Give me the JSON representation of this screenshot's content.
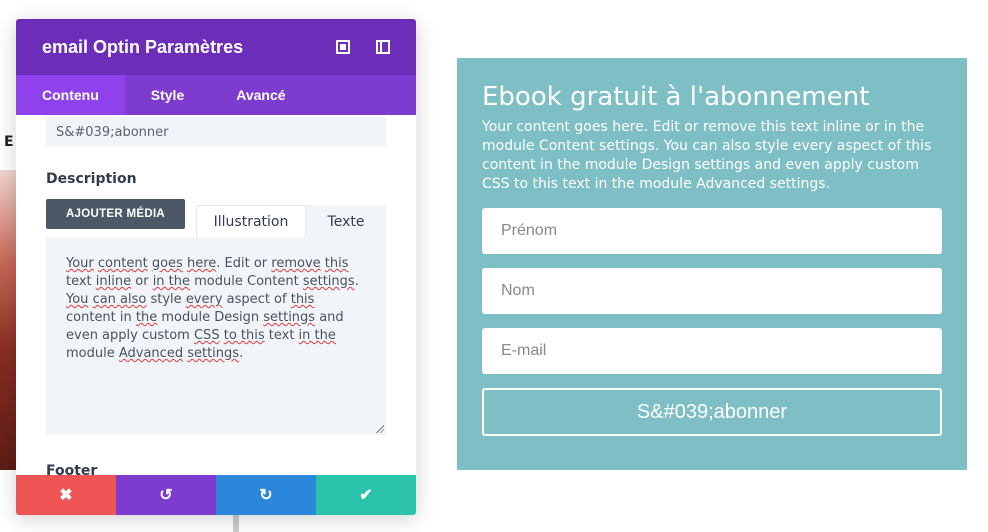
{
  "modal": {
    "title": "email Optin Paramètres",
    "tabs": [
      {
        "label": "Contenu"
      },
      {
        "label": "Style"
      },
      {
        "label": "Avancé"
      }
    ],
    "button_text_value": "S&#039;abonner",
    "description_label": "Description",
    "add_media_label": "AJOUTER MÉDIA",
    "editor_tabs": [
      {
        "label": "Illustration"
      },
      {
        "label": "Texte"
      }
    ],
    "editor_text": {
      "w1": "Your",
      "w2": "content",
      "w3": "goes",
      "w4": "here",
      "t1": ". Edit or ",
      "w5": "remove",
      "t2": " ",
      "w6": "this",
      "t3": " text ",
      "w7": "inline",
      "t4": " or ",
      "w8": "in the",
      "t5": " module Content ",
      "w9": "settings",
      "t6": ". ",
      "w10": "You",
      "t7": " ",
      "w11": "can also",
      "t8": " style ",
      "w12": "every",
      "t9": " aspect of ",
      "w13": "this",
      "t10": " content in ",
      "w14": "the",
      "t11": " module Design ",
      "w15": "settings",
      "t12": " and even apply custom ",
      "w16": "CSS",
      "t13": " ",
      "w17": "to this",
      "t14": " text ",
      "w18": "in the",
      "t15": " module ",
      "w19": "Advanced",
      "t16": " ",
      "w20": "settings",
      "t17": "."
    },
    "footer_label": "Footer",
    "actions": {
      "cancel": "✖",
      "undo": "↺",
      "redo": "↻",
      "save": "✔"
    }
  },
  "background": {
    "letter_e": "E"
  },
  "optin": {
    "title": "Ebook gratuit à l'abonnement",
    "description": "Your content goes here. Edit or remove this text inline or in the module Content settings. You can also style every aspect of this content in the module Design settings and even apply custom CSS to this text in the module Advanced settings.",
    "fields": [
      {
        "placeholder": "Prénom"
      },
      {
        "placeholder": "Nom"
      },
      {
        "placeholder": "E-mail"
      }
    ],
    "button_label": "S&#039;abonner"
  },
  "colors": {
    "header": "#6c2eb9",
    "tabs_bg": "#7e3bd0",
    "tab_active": "#8f42ec",
    "optin_bg": "#7ebec5",
    "cancel": "#ef5555",
    "redo": "#2b87da",
    "save": "#29c4a9"
  }
}
